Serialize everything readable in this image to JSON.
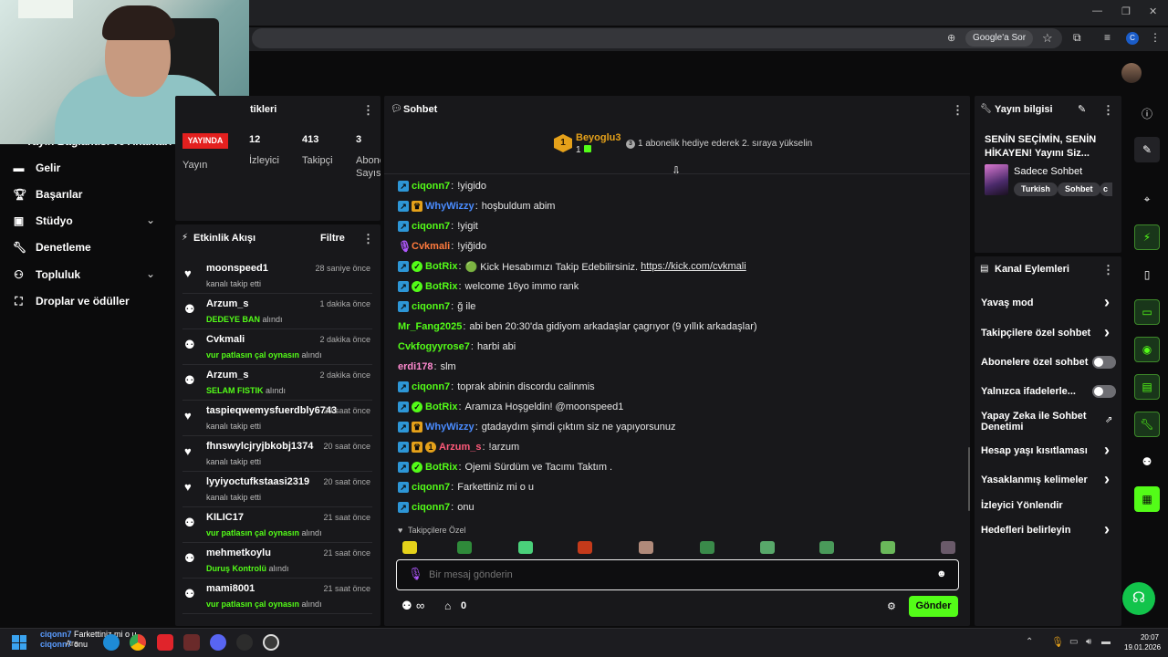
{
  "browser": {
    "google_pill": "Google'a Sor",
    "profile_letter": "C"
  },
  "sidebar": {
    "partial_item": "Yayın Bağlantısı ve Anahtarı",
    "items": [
      {
        "label": "Gelir",
        "icon": "wallet-icon"
      },
      {
        "label": "Başarılar",
        "icon": "trophy-icon"
      },
      {
        "label": "Stüdyo",
        "icon": "studio-icon",
        "expandable": true
      },
      {
        "label": "Denetleme",
        "icon": "wrench-icon"
      },
      {
        "label": "Topluluk",
        "icon": "community-icon",
        "expandable": true
      },
      {
        "label": "Droplar ve ödüller",
        "icon": "gift-icon"
      }
    ]
  },
  "stats": {
    "title_partial": "tikleri",
    "live_badge": "YAYINDA",
    "items": [
      {
        "value": "",
        "label": "Yayın"
      },
      {
        "value": "12",
        "label": "İzleyici"
      },
      {
        "value": "413",
        "label": "Takipçi"
      },
      {
        "value": "3",
        "label": "Abone",
        "label2": "Sayısı"
      }
    ]
  },
  "activity": {
    "title": "Etkinlik Akışı",
    "filter": "Filtre",
    "events": [
      {
        "user": "moonspeed1",
        "pre": "",
        "hl": "",
        "post": "kanalı takip etti",
        "time": "28 saniye önce",
        "icon": "heart-icon"
      },
      {
        "user": "Arzum_s",
        "pre": "",
        "hl": "DEDEYE BAN",
        "post": " alındı",
        "time": "1 dakika önce",
        "icon": "kick-points-icon"
      },
      {
        "user": "Cvkmali",
        "pre": "",
        "hl": "vur patlasın çal oynasın",
        "post": " alındı",
        "time": "2 dakika önce",
        "icon": "kick-points-icon"
      },
      {
        "user": "Arzum_s",
        "pre": "",
        "hl": "SELAM FISTIK",
        "post": " alındı",
        "time": "2 dakika önce",
        "icon": "kick-points-icon"
      },
      {
        "user": "taspieqwemysfuerdbly6743",
        "pre": "",
        "hl": "",
        "post": "kanalı takip etti",
        "time": "20 saat önce",
        "icon": "heart-icon"
      },
      {
        "user": "fhnswylcjryjbkobj1374",
        "pre": "",
        "hl": "",
        "post": "kanalı takip etti",
        "time": "20 saat önce",
        "icon": "heart-icon"
      },
      {
        "user": "lyyiyoctufkstaasi2319",
        "pre": "",
        "hl": "",
        "post": "kanalı takip etti",
        "time": "20 saat önce",
        "icon": "heart-icon"
      },
      {
        "user": "KILIC17",
        "pre": "",
        "hl": "vur patlasın çal oynasın",
        "post": " alındı",
        "time": "21 saat önce",
        "icon": "kick-points-icon"
      },
      {
        "user": "mehmetkoylu",
        "pre": "",
        "hl": "Duruş Kontrolü",
        "post": " alındı",
        "time": "21 saat önce",
        "icon": "kick-points-icon"
      },
      {
        "user": "mami8001",
        "pre": "",
        "hl": "vur patlasın çal oynasın",
        "post": " alındı",
        "time": "21 saat önce",
        "icon": "kick-points-icon"
      }
    ]
  },
  "chat": {
    "title": "Sohbet",
    "pinned_user": "Beyoglu3",
    "pinned_count": "1",
    "pinned_rank": "1",
    "pinned_text": "1 abonelik hediye ederek 2. sıraya yükselin",
    "messages": [
      {
        "user": "ciqonn7",
        "color": "#53fc18",
        "badges": [
          "b"
        ],
        "text": "!yigido"
      },
      {
        "user": "WhyWizzy",
        "color": "#4a8cff",
        "badges": [
          "b",
          "y"
        ],
        "text": "hoşbuldum abim"
      },
      {
        "user": "ciqonn7",
        "color": "#53fc18",
        "badges": [
          "b"
        ],
        "text": "!yigit"
      },
      {
        "user": "Cvkmali",
        "color": "#ff7a3d",
        "badges": [
          "p"
        ],
        "text": "!yiğido"
      },
      {
        "user": "BotRix",
        "color": "#53fc18",
        "badges": [
          "b",
          "g"
        ],
        "text": "🟢 Kick Hesabımızı Takip Edebilirsiniz. ",
        "link": "https://kick.com/cvkmali"
      },
      {
        "user": "BotRix",
        "color": "#53fc18",
        "badges": [
          "b",
          "g"
        ],
        "text": "welcome 16yo immo rank"
      },
      {
        "user": "ciqonn7",
        "color": "#53fc18",
        "badges": [
          "b"
        ],
        "text": "ğ ile"
      },
      {
        "user": "Mr_Fang2025",
        "color": "#53fc18",
        "badges": [],
        "text": "abi ben 20:30'da gidiyom arkadaşlar çagrıyor (9 yıllık arkadaşlar)"
      },
      {
        "user": "Cvkfogyyrose7",
        "color": "#53fc18",
        "badges": [],
        "text": "harbi abi"
      },
      {
        "user": "erdi178",
        "color": "#ff8ad0",
        "badges": [],
        "text": "slm"
      },
      {
        "user": "ciqonn7",
        "color": "#53fc18",
        "badges": [
          "b"
        ],
        "text": "toprak abinin discordu calinmis"
      },
      {
        "user": "BotRix",
        "color": "#53fc18",
        "badges": [
          "b",
          "g"
        ],
        "text": "Aramıza Hoşgeldin! @moonspeed1"
      },
      {
        "user": "WhyWizzy",
        "color": "#4a8cff",
        "badges": [
          "b",
          "y"
        ],
        "text": "gtadaydım şimdi çıktım siz ne yapıyorsunuz"
      },
      {
        "user": "Arzum_s",
        "color": "#ff5a7a",
        "badges": [
          "b",
          "y",
          "y1"
        ],
        "text": "!arzum"
      },
      {
        "user": "BotRix",
        "color": "#53fc18",
        "badges": [
          "b",
          "g"
        ],
        "text": "Ojemi Sürdüm ve Tacımı Taktım ."
      },
      {
        "user": "ciqonn7",
        "color": "#53fc18",
        "badges": [
          "b"
        ],
        "text": "Farkettiniz mi o u"
      },
      {
        "user": "ciqonn7",
        "color": "#53fc18",
        "badges": [
          "b"
        ],
        "text": "onu"
      }
    ],
    "emote_label": "Takipçilere Özel",
    "input_placeholder": "Bir mesaj gönderin",
    "points": "∞",
    "store_count": "0",
    "send_label": "Gönder"
  },
  "stream_info": {
    "title": "Yayın bilgisi",
    "stream_title": "SENİN SEÇİMİN, SENİN HİKAYEN! Yayını Siz...",
    "category": "Sadece Sohbet",
    "tags": [
      "Turkish",
      "Sohbet",
      "c"
    ]
  },
  "channel_actions": {
    "title": "Kanal Eylemleri",
    "items": [
      {
        "label": "Yavaş mod",
        "kind": "arrow"
      },
      {
        "label": "Takipçilere özel sohbet",
        "kind": "arrow"
      },
      {
        "label": "Abonelere özel sohbet",
        "kind": "toggle"
      },
      {
        "label": "Yalnızca ifadelerle...",
        "kind": "toggle"
      },
      {
        "label": "Yapay Zeka ile Sohbet",
        "label2": "Denetimi",
        "kind": "external"
      },
      {
        "label": "Hesap yaşı kısıtlaması",
        "kind": "arrow"
      },
      {
        "label": "Yasaklanmış kelimeler",
        "kind": "arrow"
      },
      {
        "label": "İzleyici Yönlendir",
        "kind": "none"
      },
      {
        "label": "Hedefleri belirleyin",
        "kind": "arrow"
      }
    ]
  },
  "taskbar": {
    "toast_user": "ciqonn7",
    "toast_text1": "Farkettiniz mi o u",
    "toast_text2": "onu",
    "search_partial": "Ara",
    "time": "20:07",
    "date": "19.01.2026"
  },
  "colors": {
    "accent": "#53fc18",
    "panel": "#18181b",
    "live": "#e4201f"
  }
}
